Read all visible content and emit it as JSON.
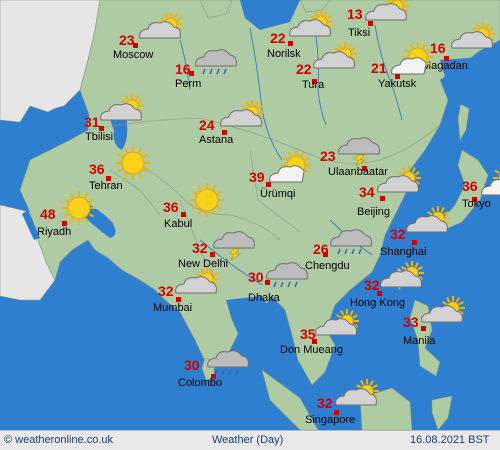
{
  "map": {
    "colors": {
      "sea": "#2f7fd1",
      "land": "#aecba3",
      "foreign_land": "#e6e6e6",
      "border": "#8a9a8a",
      "river": "#3b78c8",
      "temp": "#d40000"
    },
    "cities": [
      {
        "name": "Moscow",
        "temp": "23",
        "weather": "partly-cloudy"
      },
      {
        "name": "Norilsk",
        "temp": "22",
        "weather": "partly-cloudy"
      },
      {
        "name": "Tiksi",
        "temp": "13",
        "weather": "partly-cloudy"
      },
      {
        "name": "Magadan",
        "temp": "16",
        "weather": "partly-cloudy"
      },
      {
        "name": "Perm",
        "temp": "16",
        "weather": "rain"
      },
      {
        "name": "Tura",
        "temp": "22",
        "weather": "partly-cloudy"
      },
      {
        "name": "Yakutsk",
        "temp": "21",
        "weather": "sunny-cloud"
      },
      {
        "name": "Tbilisi",
        "temp": "31",
        "weather": "partly-cloudy"
      },
      {
        "name": "Astana",
        "temp": "24",
        "weather": "partly-cloudy"
      },
      {
        "name": "Ulaanbaatar",
        "temp": "23",
        "weather": "thunderstorm"
      },
      {
        "name": "Tehran",
        "temp": "36",
        "weather": "sunny"
      },
      {
        "name": "Ürümqi",
        "temp": "39",
        "weather": "sunny-cloud"
      },
      {
        "name": "Tokyo",
        "temp": "36",
        "weather": "sunny-cloud"
      },
      {
        "name": "Riyadh",
        "temp": "48",
        "weather": "sunny"
      },
      {
        "name": "Kabul",
        "temp": "36",
        "weather": "sunny"
      },
      {
        "name": "Beijing",
        "temp": "34",
        "weather": "partly-cloudy"
      },
      {
        "name": "Shanghai",
        "temp": "32",
        "weather": "partly-cloudy"
      },
      {
        "name": "New Delhi",
        "temp": "32",
        "weather": "thunderstorm"
      },
      {
        "name": "Chengdu",
        "temp": "26",
        "weather": "rain"
      },
      {
        "name": "Dhaka",
        "temp": "30",
        "weather": "rain"
      },
      {
        "name": "Mumbai",
        "temp": "32",
        "weather": "partly-cloudy"
      },
      {
        "name": "Hong Kong",
        "temp": "32",
        "weather": "partly-cloudy"
      },
      {
        "name": "Manila",
        "temp": "33",
        "weather": "partly-cloudy"
      },
      {
        "name": "Don Mueang",
        "temp": "35",
        "weather": "partly-cloudy"
      },
      {
        "name": "Colombo",
        "temp": "30",
        "weather": "rain"
      },
      {
        "name": "Singapore",
        "temp": "32",
        "weather": "partly-cloudy"
      }
    ]
  },
  "footer": {
    "copyright": "© weatheronline.co.uk",
    "title": "Weather (Day)",
    "datetime": "16.08.2021 BST"
  }
}
